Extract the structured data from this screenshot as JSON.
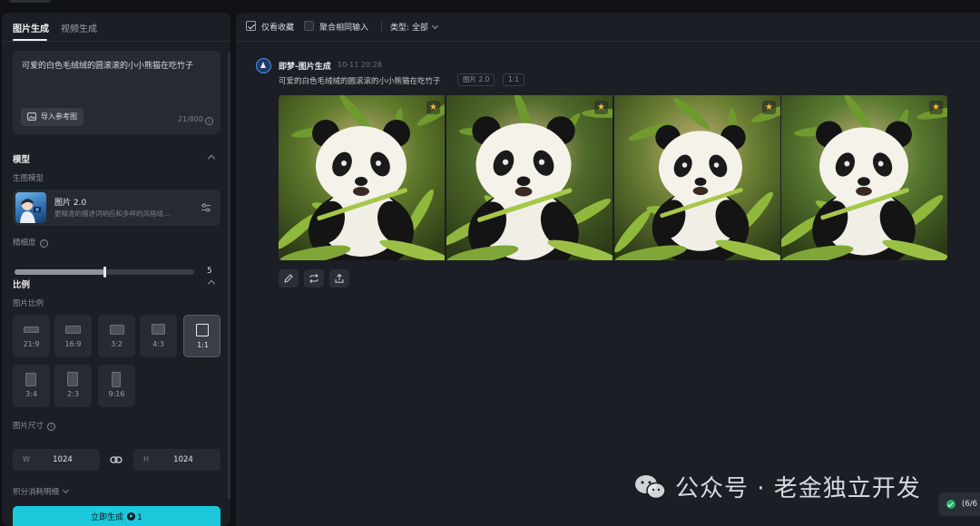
{
  "left_panel": {
    "tabs": [
      {
        "label": "图片生成",
        "active": true
      },
      {
        "label": "视频生成",
        "active": false
      }
    ],
    "prompt": {
      "text": "可爱的白色毛绒绒的圆滚滚的小小熊猫在吃竹子",
      "ref_button": "导入参考图",
      "counter": "21/800"
    },
    "model_section": {
      "title": "模型",
      "sub_label": "生图模型",
      "model_name": "图片 2.0",
      "model_desc": "更精准的描述词响应和多样的风格组…",
      "precision_label": "精细度",
      "precision_value": "5",
      "precision_fraction": 0.5
    },
    "ratio_section": {
      "title": "比例",
      "sub_label": "图片比例",
      "ratios": [
        "21:9",
        "16:9",
        "3:2",
        "4:3",
        "1:1",
        "3:4",
        "2:3",
        "9:16"
      ],
      "selected": "1:1"
    },
    "size_section": {
      "label": "图片尺寸",
      "width_prefix": "W",
      "width": "1024",
      "height_prefix": "H",
      "height": "1024"
    },
    "credits_label": "积分消耗明细",
    "generate_button": "立即生成",
    "generate_cost": "1",
    "accent_color": "#1cc8dc"
  },
  "right_panel": {
    "filters": {
      "favorites_only": "仅看收藏",
      "favorites_checked": true,
      "aggregate": "聚合相同输入",
      "aggregate_checked": false,
      "type_label": "类型: 全部"
    },
    "record": {
      "title": "即梦-图片生成",
      "date": "10-11  20:28",
      "prompt": "可爱的白色毛绒绒的圆滚滚的小小熊猫在吃竹子",
      "tags": [
        "图片 2.0",
        "1:1"
      ],
      "image_count": 4,
      "actions": [
        "edit-icon",
        "regenerate-icon",
        "export-icon"
      ]
    }
  },
  "overlay": {
    "watermark": "公众号 · 老金独立开发",
    "status_text": "(6/6"
  }
}
